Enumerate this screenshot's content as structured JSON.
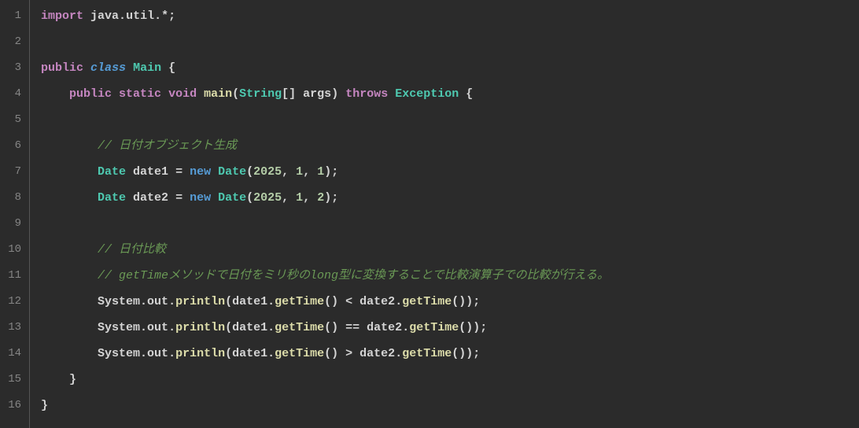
{
  "lineCount": 16,
  "code": {
    "lines": [
      {
        "n": 1,
        "tokens": [
          {
            "t": "import",
            "c": "tok-keyword"
          },
          {
            "t": " ",
            "c": "tok-punct"
          },
          {
            "t": "java",
            "c": "tok-var"
          },
          {
            "t": ".",
            "c": "tok-punct"
          },
          {
            "t": "util",
            "c": "tok-var"
          },
          {
            "t": ".*;",
            "c": "tok-punct"
          }
        ]
      },
      {
        "n": 2,
        "tokens": []
      },
      {
        "n": 3,
        "tokens": [
          {
            "t": "public",
            "c": "tok-keyword"
          },
          {
            "t": " ",
            "c": "tok-punct"
          },
          {
            "t": "class",
            "c": "tok-keyword2"
          },
          {
            "t": " ",
            "c": "tok-punct"
          },
          {
            "t": "Main",
            "c": "tok-classname"
          },
          {
            "t": " {",
            "c": "tok-punct"
          }
        ]
      },
      {
        "n": 4,
        "tokens": [
          {
            "t": "    ",
            "c": "tok-punct"
          },
          {
            "t": "public",
            "c": "tok-keyword"
          },
          {
            "t": " ",
            "c": "tok-punct"
          },
          {
            "t": "static",
            "c": "tok-keyword"
          },
          {
            "t": " ",
            "c": "tok-punct"
          },
          {
            "t": "void",
            "c": "tok-keyword"
          },
          {
            "t": " ",
            "c": "tok-punct"
          },
          {
            "t": "main",
            "c": "tok-funcdef"
          },
          {
            "t": "(",
            "c": "tok-punct"
          },
          {
            "t": "String",
            "c": "tok-typeuse"
          },
          {
            "t": "[] ",
            "c": "tok-punct"
          },
          {
            "t": "args",
            "c": "tok-var"
          },
          {
            "t": ") ",
            "c": "tok-punct"
          },
          {
            "t": "throws",
            "c": "tok-keyword"
          },
          {
            "t": " ",
            "c": "tok-punct"
          },
          {
            "t": "Exception",
            "c": "tok-typeuse"
          },
          {
            "t": " {",
            "c": "tok-punct"
          }
        ]
      },
      {
        "n": 5,
        "tokens": []
      },
      {
        "n": 6,
        "tokens": [
          {
            "t": "        ",
            "c": "tok-punct"
          },
          {
            "t": "// 日付オブジェクト生成",
            "c": "tok-comment"
          }
        ]
      },
      {
        "n": 7,
        "tokens": [
          {
            "t": "        ",
            "c": "tok-punct"
          },
          {
            "t": "Date",
            "c": "tok-typeuse"
          },
          {
            "t": " ",
            "c": "tok-punct"
          },
          {
            "t": "date1",
            "c": "tok-var"
          },
          {
            "t": " = ",
            "c": "tok-op"
          },
          {
            "t": "new",
            "c": "tok-new"
          },
          {
            "t": " ",
            "c": "tok-punct"
          },
          {
            "t": "Date",
            "c": "tok-typeuse"
          },
          {
            "t": "(",
            "c": "tok-punct"
          },
          {
            "t": "2025",
            "c": "tok-number"
          },
          {
            "t": ", ",
            "c": "tok-punct"
          },
          {
            "t": "1",
            "c": "tok-number"
          },
          {
            "t": ", ",
            "c": "tok-punct"
          },
          {
            "t": "1",
            "c": "tok-number"
          },
          {
            "t": ");",
            "c": "tok-punct"
          }
        ]
      },
      {
        "n": 8,
        "tokens": [
          {
            "t": "        ",
            "c": "tok-punct"
          },
          {
            "t": "Date",
            "c": "tok-typeuse"
          },
          {
            "t": " ",
            "c": "tok-punct"
          },
          {
            "t": "date2",
            "c": "tok-var"
          },
          {
            "t": " = ",
            "c": "tok-op"
          },
          {
            "t": "new",
            "c": "tok-new"
          },
          {
            "t": " ",
            "c": "tok-punct"
          },
          {
            "t": "Date",
            "c": "tok-typeuse"
          },
          {
            "t": "(",
            "c": "tok-punct"
          },
          {
            "t": "2025",
            "c": "tok-number"
          },
          {
            "t": ", ",
            "c": "tok-punct"
          },
          {
            "t": "1",
            "c": "tok-number"
          },
          {
            "t": ", ",
            "c": "tok-punct"
          },
          {
            "t": "2",
            "c": "tok-number"
          },
          {
            "t": ");",
            "c": "tok-punct"
          }
        ]
      },
      {
        "n": 9,
        "tokens": []
      },
      {
        "n": 10,
        "tokens": [
          {
            "t": "        ",
            "c": "tok-punct"
          },
          {
            "t": "// 日付比較",
            "c": "tok-comment"
          }
        ]
      },
      {
        "n": 11,
        "tokens": [
          {
            "t": "        ",
            "c": "tok-punct"
          },
          {
            "t": "// getTimeメソッドで日付をミリ秒のlong型に変換することで比較演算子での比較が行える。",
            "c": "tok-comment"
          }
        ]
      },
      {
        "n": 12,
        "tokens": [
          {
            "t": "        ",
            "c": "tok-punct"
          },
          {
            "t": "System",
            "c": "tok-var"
          },
          {
            "t": ".",
            "c": "tok-punct"
          },
          {
            "t": "out",
            "c": "tok-prop"
          },
          {
            "t": ".",
            "c": "tok-punct"
          },
          {
            "t": "println",
            "c": "tok-method"
          },
          {
            "t": "(",
            "c": "tok-punct"
          },
          {
            "t": "date1",
            "c": "tok-var"
          },
          {
            "t": ".",
            "c": "tok-punct"
          },
          {
            "t": "getTime",
            "c": "tok-method"
          },
          {
            "t": "() < ",
            "c": "tok-punct"
          },
          {
            "t": "date2",
            "c": "tok-var"
          },
          {
            "t": ".",
            "c": "tok-punct"
          },
          {
            "t": "getTime",
            "c": "tok-method"
          },
          {
            "t": "());",
            "c": "tok-punct"
          }
        ]
      },
      {
        "n": 13,
        "tokens": [
          {
            "t": "        ",
            "c": "tok-punct"
          },
          {
            "t": "System",
            "c": "tok-var"
          },
          {
            "t": ".",
            "c": "tok-punct"
          },
          {
            "t": "out",
            "c": "tok-prop"
          },
          {
            "t": ".",
            "c": "tok-punct"
          },
          {
            "t": "println",
            "c": "tok-method"
          },
          {
            "t": "(",
            "c": "tok-punct"
          },
          {
            "t": "date1",
            "c": "tok-var"
          },
          {
            "t": ".",
            "c": "tok-punct"
          },
          {
            "t": "getTime",
            "c": "tok-method"
          },
          {
            "t": "() == ",
            "c": "tok-punct"
          },
          {
            "t": "date2",
            "c": "tok-var"
          },
          {
            "t": ".",
            "c": "tok-punct"
          },
          {
            "t": "getTime",
            "c": "tok-method"
          },
          {
            "t": "());",
            "c": "tok-punct"
          }
        ]
      },
      {
        "n": 14,
        "tokens": [
          {
            "t": "        ",
            "c": "tok-punct"
          },
          {
            "t": "System",
            "c": "tok-var"
          },
          {
            "t": ".",
            "c": "tok-punct"
          },
          {
            "t": "out",
            "c": "tok-prop"
          },
          {
            "t": ".",
            "c": "tok-punct"
          },
          {
            "t": "println",
            "c": "tok-method"
          },
          {
            "t": "(",
            "c": "tok-punct"
          },
          {
            "t": "date1",
            "c": "tok-var"
          },
          {
            "t": ".",
            "c": "tok-punct"
          },
          {
            "t": "getTime",
            "c": "tok-method"
          },
          {
            "t": "() > ",
            "c": "tok-punct"
          },
          {
            "t": "date2",
            "c": "tok-var"
          },
          {
            "t": ".",
            "c": "tok-punct"
          },
          {
            "t": "getTime",
            "c": "tok-method"
          },
          {
            "t": "());",
            "c": "tok-punct"
          }
        ]
      },
      {
        "n": 15,
        "tokens": [
          {
            "t": "    }",
            "c": "tok-punct"
          }
        ]
      },
      {
        "n": 16,
        "tokens": [
          {
            "t": "}",
            "c": "tok-punct"
          }
        ]
      }
    ]
  }
}
